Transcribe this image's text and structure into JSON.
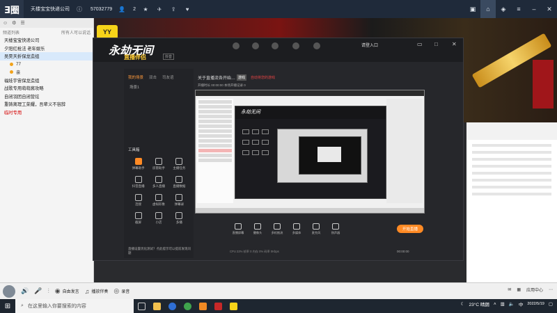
{
  "topbar": {
    "logo": "Ǝ圈",
    "room_name": "天楼宝宝快递公司",
    "room_id": "57032779",
    "online_count": "2",
    "right_buttons": [
      "film-icon",
      "home-icon",
      "gamepad-icon",
      "menu-icon",
      "minimize-icon",
      "close-icon"
    ]
  },
  "left_panel": {
    "header_left": "频道列表",
    "header_right": "所有人可以说话",
    "items": [
      {
        "label": "天楼宝宝快递公司",
        "type": "channel"
      },
      {
        "label": "夕阳红枪法  老年娱乐",
        "type": "channel"
      },
      {
        "label": "吴昊天折保龙造组",
        "type": "channel",
        "selected": true
      },
      {
        "label": "77",
        "type": "user"
      },
      {
        "label": "亲",
        "type": "user"
      },
      {
        "label": "福娃宇宙保龙造组",
        "type": "channel"
      },
      {
        "label": "战歌专用萌萌酱攻略",
        "type": "channel"
      },
      {
        "label": "自闭羽团自闭营炫",
        "type": "channel"
      },
      {
        "label": "重铸离理工荣耀，吾辈义不容辞",
        "type": "channel"
      },
      {
        "label": "临时专用",
        "type": "channel",
        "red": true
      }
    ]
  },
  "app": {
    "brand_title": "永劫无间",
    "brand_sub": "直播伴侣",
    "version": "抖音",
    "login": "请登入口",
    "tabs": [
      "我的场景",
      "双击",
      "司友谊"
    ],
    "scene": "场景1",
    "tools_label": "工具箱",
    "tools": [
      {
        "label": "弹幕助手",
        "orange": true
      },
      {
        "label": "房管助手"
      },
      {
        "label": "主播任务"
      },
      {
        "label": "抖音直播"
      },
      {
        "label": "多人直播"
      },
      {
        "label": "直播数据"
      },
      {
        "label": "连接"
      },
      {
        "label": "虚拟形象"
      },
      {
        "label": "弹幕录"
      },
      {
        "label": "截屏"
      },
      {
        "label": "小店"
      },
      {
        "label": "多播"
      }
    ],
    "tip": "直播设置优化测试？点此提示可以提前发现问题",
    "top_title": "关于直播流各开始…",
    "top_tag": "游戏",
    "top_warning": "自动将您的游戏",
    "top_sub": "开播时长 00:00:00    本场开播记录    0",
    "controls": [
      {
        "label": "直播屏幕"
      },
      {
        "label": "摄像头"
      },
      {
        "label": "多机推流"
      },
      {
        "label": "多媒体"
      },
      {
        "label": "麦克风"
      },
      {
        "label": "扬声器"
      }
    ],
    "start_button": "开始直播",
    "stats": "CPU 22%   帧率 0   内存 0%   码率 0Kbps",
    "timer": "00:00:00"
  },
  "chat_bar": {
    "voice_label": "自由发言",
    "music_label": "播放伴奏",
    "record_label": "录音",
    "app_center": "应用中心"
  },
  "taskbar": {
    "search_placeholder": "在这里输入你要搜索的内容",
    "weather": "23°C 晴朗",
    "date": "2022/5/19",
    "input_method": "中"
  }
}
